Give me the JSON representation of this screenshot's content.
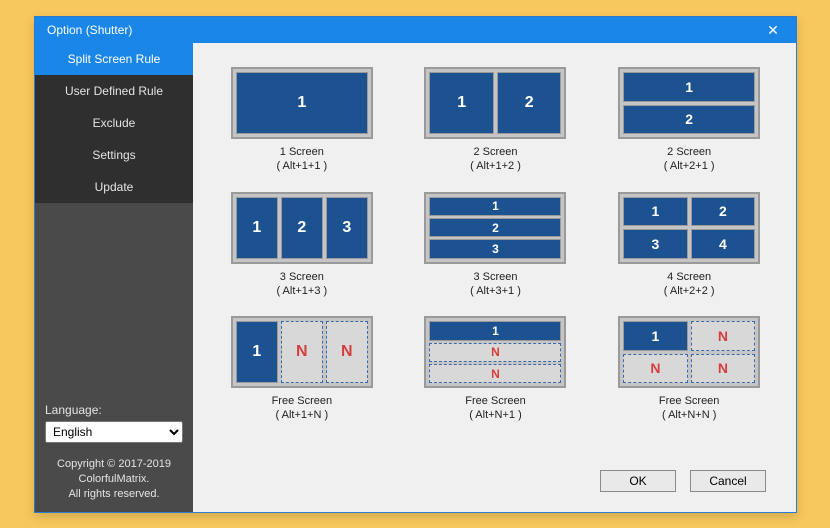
{
  "window": {
    "title": "Option (Shutter)"
  },
  "sidebar": {
    "items": [
      {
        "label": "Split Screen Rule",
        "active": true
      },
      {
        "label": "User Defined Rule"
      },
      {
        "label": "Exclude"
      },
      {
        "label": "Settings"
      },
      {
        "label": "Update"
      }
    ],
    "language_label": "Language:",
    "language_value": "English",
    "copyright_line1": "Copyright © 2017-2019",
    "copyright_line2": "ColorfulMatrix.",
    "copyright_line3": "All rights reserved."
  },
  "layouts": [
    {
      "title": "1 Screen",
      "shortcut": "( Alt+1+1 )"
    },
    {
      "title": "2 Screen",
      "shortcut": "( Alt+1+2 )"
    },
    {
      "title": "2 Screen",
      "shortcut": "( Alt+2+1 )"
    },
    {
      "title": "3 Screen",
      "shortcut": "( Alt+1+3 )"
    },
    {
      "title": "3 Screen",
      "shortcut": "( Alt+3+1 )"
    },
    {
      "title": "4 Screen",
      "shortcut": "( Alt+2+2 )"
    },
    {
      "title": "Free Screen",
      "shortcut": "( Alt+1+N )"
    },
    {
      "title": "Free Screen",
      "shortcut": "( Alt+N+1 )"
    },
    {
      "title": "Free Screen",
      "shortcut": "( Alt+N+N )"
    }
  ],
  "footer": {
    "ok": "OK",
    "cancel": "Cancel"
  },
  "glyph": {
    "n": "N"
  }
}
